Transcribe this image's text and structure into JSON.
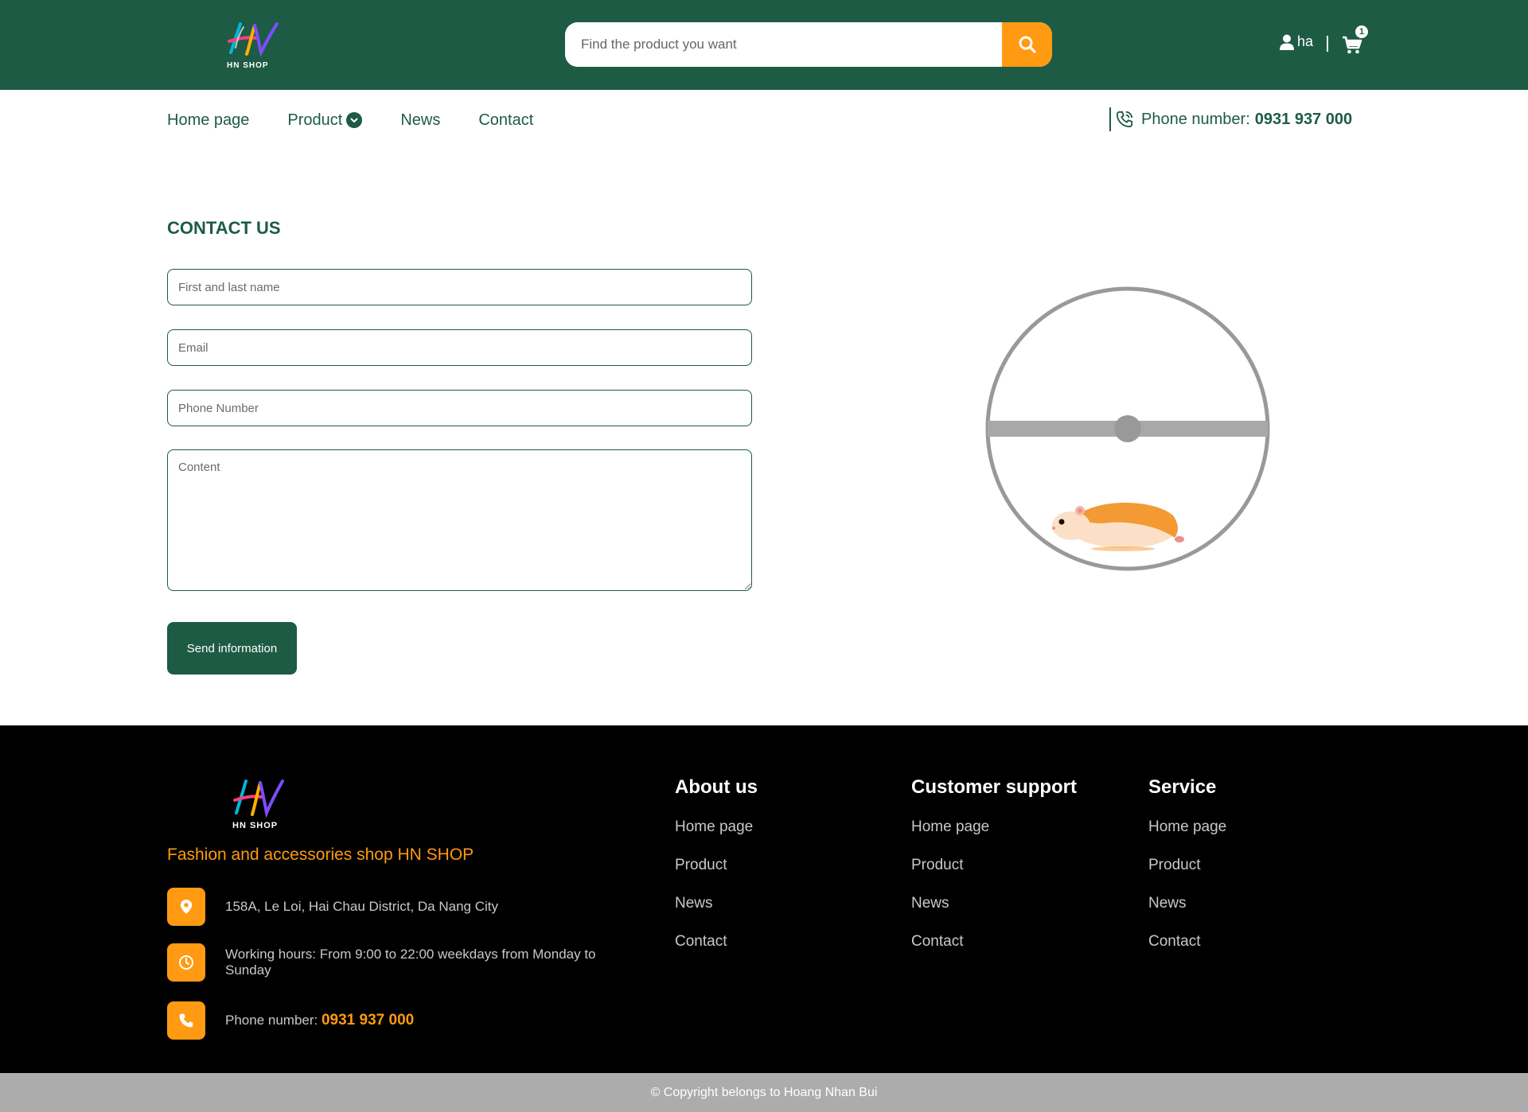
{
  "header": {
    "logo_text": "HN SHOP",
    "search_placeholder": "Find the product you want",
    "user_name": "ha",
    "cart_count": "1"
  },
  "nav": {
    "items": [
      {
        "label": "Home page"
      },
      {
        "label": "Product"
      },
      {
        "label": "News"
      },
      {
        "label": "Contact"
      }
    ],
    "phone_label": "Phone number:",
    "phone_number": "0931 937 000"
  },
  "contact": {
    "title": "CONTACT US",
    "name_placeholder": "First and last name",
    "email_placeholder": "Email",
    "phone_placeholder": "Phone Number",
    "content_placeholder": "Content",
    "send_label": "Send information"
  },
  "footer": {
    "logo_text": "HN SHOP",
    "tagline": "Fashion and accessories shop HN SHOP",
    "address": "158A, Le Loi, Hai Chau District, Da Nang City",
    "hours": "Working hours: From 9:00 to 22:00 weekdays from Monday to Sunday",
    "phone_label": "Phone number:",
    "phone_number": "0931 937 000",
    "columns": [
      {
        "title": "About us",
        "links": [
          "Home page",
          "Product",
          "News",
          "Contact"
        ]
      },
      {
        "title": "Customer support",
        "links": [
          "Home page",
          "Product",
          "News",
          "Contact"
        ]
      },
      {
        "title": "Service",
        "links": [
          "Home page",
          "Product",
          "News",
          "Contact"
        ]
      }
    ],
    "copyright": "© Copyright belongs to Hoang Nhan Bui"
  },
  "colors": {
    "brand_green": "#1e5b45",
    "accent_orange": "#ff9a12",
    "footer_bg": "#000000",
    "copyright_bg": "#acacac"
  },
  "icons": [
    "search-icon",
    "user-icon",
    "cart-icon",
    "chevron-down-icon",
    "phone-icon",
    "location-icon",
    "clock-icon"
  ]
}
